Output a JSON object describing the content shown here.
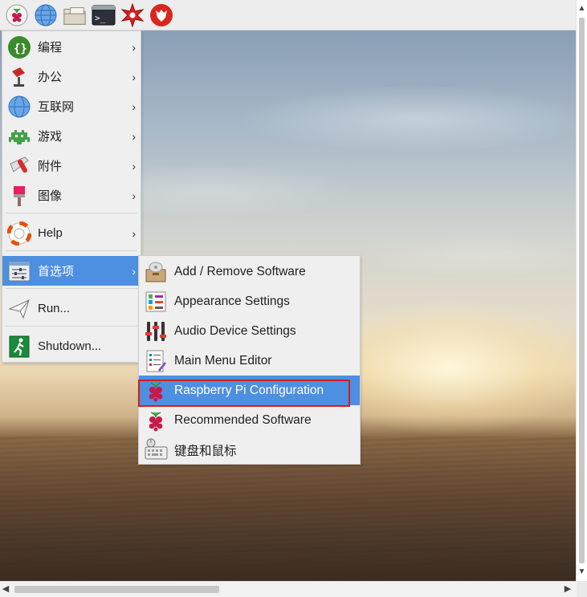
{
  "taskbar": {
    "items": [
      {
        "name": "raspberry-menu-icon"
      },
      {
        "name": "web-browser-icon"
      },
      {
        "name": "file-manager-icon"
      },
      {
        "name": "terminal-icon"
      },
      {
        "name": "mathematica-icon"
      },
      {
        "name": "wolfram-icon"
      }
    ],
    "terminal_glyph": ">_"
  },
  "main_menu": {
    "items": [
      {
        "label": "编程",
        "icon": "programming-icon",
        "has_submenu": true
      },
      {
        "label": "办公",
        "icon": "office-icon",
        "has_submenu": true
      },
      {
        "label": "互联网",
        "icon": "internet-icon",
        "has_submenu": true
      },
      {
        "label": "游戏",
        "icon": "games-icon",
        "has_submenu": true
      },
      {
        "label": "附件",
        "icon": "accessories-icon",
        "has_submenu": true
      },
      {
        "label": "图像",
        "icon": "graphics-icon",
        "has_submenu": true
      },
      {
        "label": "Help",
        "icon": "help-icon",
        "has_submenu": true
      },
      {
        "label": "首选项",
        "icon": "preferences-icon",
        "has_submenu": true
      },
      {
        "label": "Run...",
        "icon": "run-icon",
        "has_submenu": false
      },
      {
        "label": "Shutdown...",
        "icon": "shutdown-icon",
        "has_submenu": false
      }
    ],
    "active_item": "首选项"
  },
  "preferences_submenu": {
    "items": [
      {
        "label": "Add / Remove Software",
        "icon": "package-icon"
      },
      {
        "label": "Appearance Settings",
        "icon": "appearance-icon"
      },
      {
        "label": "Audio Device Settings",
        "icon": "audio-mixer-icon"
      },
      {
        "label": "Main Menu Editor",
        "icon": "menu-editor-icon"
      },
      {
        "label": "Raspberry Pi Configuration",
        "icon": "raspberry-icon"
      },
      {
        "label": "Recommended Software",
        "icon": "raspberry-icon"
      },
      {
        "label": "键盘和鼠标",
        "icon": "keyboard-mouse-icon"
      }
    ],
    "active_item": "Raspberry Pi Configuration"
  },
  "arrow_glyph": "›",
  "colors": {
    "highlight": "#4d8fe0",
    "annotation_box": "#d21e1e",
    "menu_bg": "#efefef"
  }
}
